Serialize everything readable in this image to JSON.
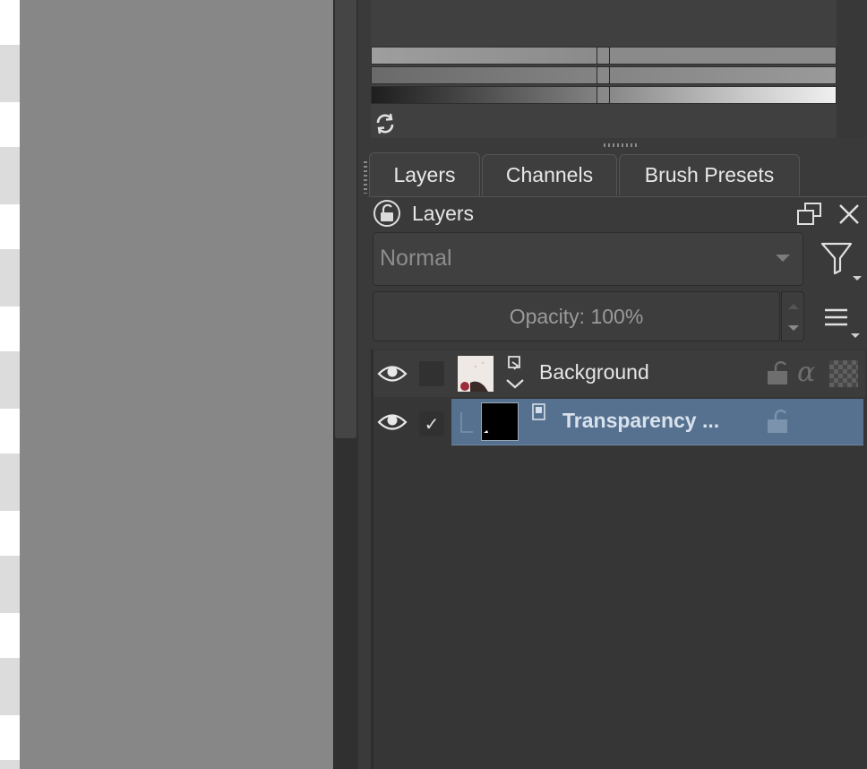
{
  "tabs": [
    {
      "label": "Layers"
    },
    {
      "label": "Channels"
    },
    {
      "label": "Brush Presets"
    }
  ],
  "docker": {
    "title": "Layers",
    "blend_mode": "Normal",
    "opacity_label": "Opacity:  100%"
  },
  "layers": [
    {
      "name": "Background",
      "visible": true,
      "checked": false
    },
    {
      "name": "Transparency ...",
      "visible": true,
      "checked": true,
      "selected": true,
      "check_mark": "✓"
    }
  ],
  "colors": {
    "selection": "#55718f",
    "panel": "#3a3a3a",
    "canvas": "#878787"
  },
  "icons": [
    "refresh-icon",
    "lock-icon",
    "float-icon",
    "close-icon",
    "filter-icon",
    "hamburger-menu-icon",
    "eye-icon",
    "inherit-alpha-icon",
    "transparency-mask-icon"
  ]
}
